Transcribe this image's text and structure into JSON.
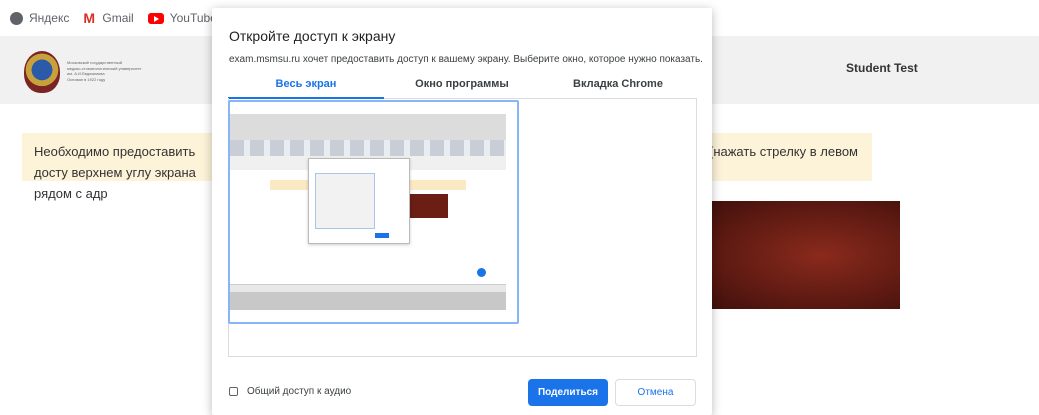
{
  "bookmarks": [
    {
      "label": "Яндекс",
      "icon": "globe-icon"
    },
    {
      "label": "Gmail",
      "icon": "gmail-icon"
    },
    {
      "label": "YouTube",
      "icon": "youtube-icon"
    },
    {
      "label": "",
      "icon": "maps-icon"
    }
  ],
  "site": {
    "university_lines": [
      "Московский государственный",
      "медико-стоматологический университет",
      "им. А.И.Евдокимова",
      "Основан в 1922 году"
    ],
    "user_name": "Student Test"
  },
  "page": {
    "notice_left": "Необходимо предоставить досту верхнем углу экрана рядом с адр",
    "notice_right": "(нажать стрелку в левом"
  },
  "dialog": {
    "title": "Откройте доступ к экрану",
    "description": "exam.msmsu.ru хочет предоставить доступ к вашему экрану. Выберите окно, которое нужно показать.",
    "tabs": [
      {
        "label": "Весь экран",
        "active": true
      },
      {
        "label": "Окно программы",
        "active": false
      },
      {
        "label": "Вкладка Chrome",
        "active": false
      }
    ],
    "audio_label": "Общий доступ к аудио",
    "audio_checked": false,
    "share_label": "Поделиться",
    "cancel_label": "Отмена"
  },
  "colors": {
    "accent": "#1a73e8",
    "notice_bg": "#fdf3d9",
    "header_bg": "#f1f1f1",
    "video_color": "#6a1e14"
  }
}
